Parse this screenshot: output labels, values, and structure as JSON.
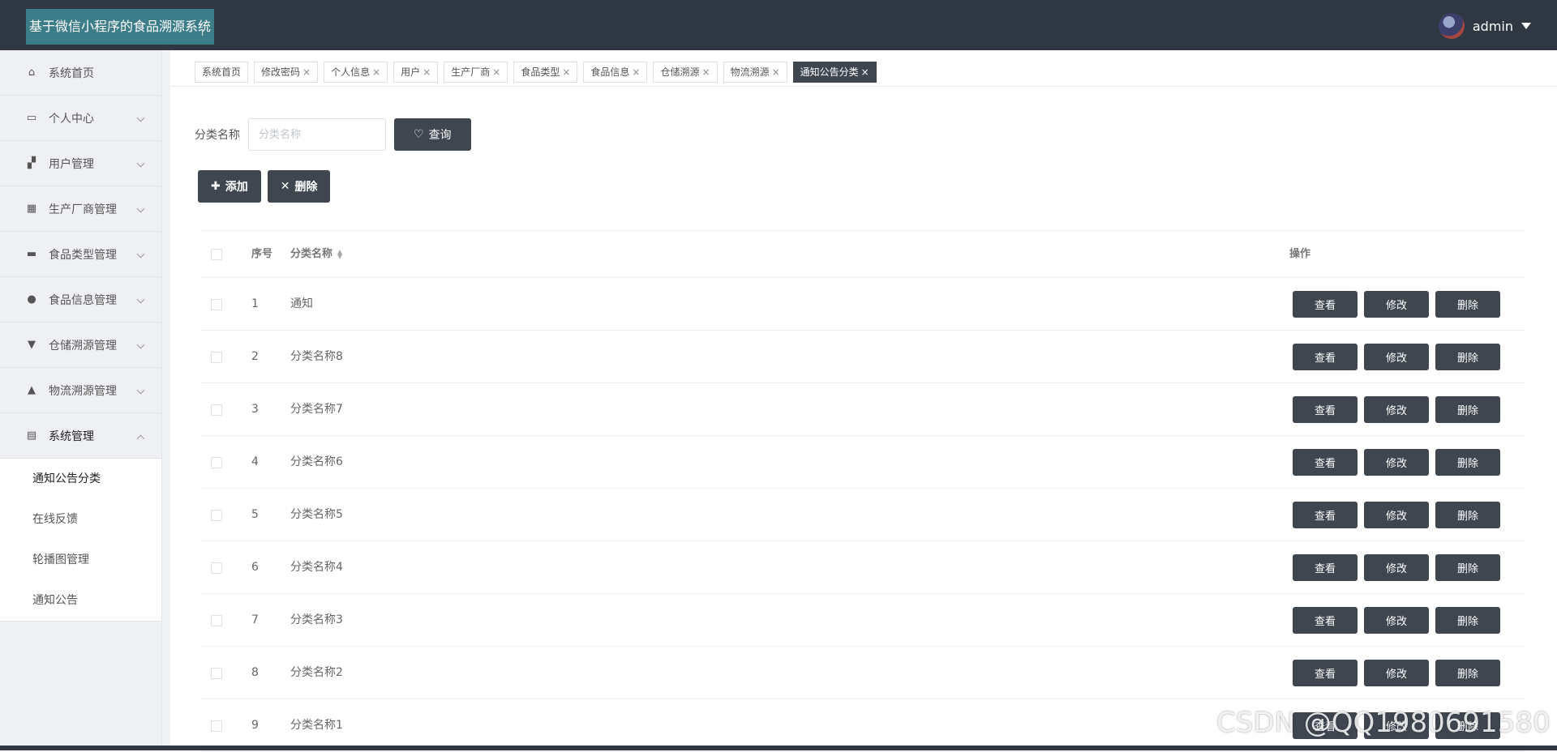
{
  "header": {
    "app_title": "基于微信小程序的食品溯源系统",
    "username": "admin"
  },
  "sidebar": {
    "items": [
      {
        "label": "系统首页",
        "icon": "home-icon",
        "glyph": "⌂",
        "expandable": false
      },
      {
        "label": "个人中心",
        "icon": "card-icon",
        "glyph": "▭",
        "expandable": true
      },
      {
        "label": "用户管理",
        "icon": "user-icon",
        "glyph": "▞",
        "expandable": true
      },
      {
        "label": "生产厂商管理",
        "icon": "grid-icon",
        "glyph": "▦",
        "expandable": true
      },
      {
        "label": "食品类型管理",
        "icon": "chat-icon",
        "glyph": "▬",
        "expandable": true
      },
      {
        "label": "食品信息管理",
        "icon": "pin-icon",
        "glyph": "●",
        "expandable": true
      },
      {
        "label": "仓储溯源管理",
        "icon": "stamp-icon",
        "glyph": "▼",
        "expandable": true
      },
      {
        "label": "物流溯源管理",
        "icon": "person-icon",
        "glyph": "▲",
        "expandable": true
      },
      {
        "label": "系统管理",
        "icon": "clipboard-icon",
        "glyph": "▤",
        "expandable": true,
        "open": true
      }
    ],
    "submenu": [
      "通知公告分类",
      "在线反馈",
      "轮播图管理",
      "通知公告"
    ]
  },
  "tabs": [
    {
      "label": "系统首页",
      "closable": false
    },
    {
      "label": "修改密码",
      "closable": true
    },
    {
      "label": "个人信息",
      "closable": true
    },
    {
      "label": "用户",
      "closable": true
    },
    {
      "label": "生产厂商",
      "closable": true
    },
    {
      "label": "食品类型",
      "closable": true
    },
    {
      "label": "食品信息",
      "closable": true
    },
    {
      "label": "仓储溯源",
      "closable": true
    },
    {
      "label": "物流溯源",
      "closable": true
    },
    {
      "label": "通知公告分类",
      "closable": true,
      "active": true
    }
  ],
  "search": {
    "label": "分类名称",
    "placeholder": "分类名称",
    "button": "查询"
  },
  "actions": {
    "add": "添加",
    "delete": "删除"
  },
  "table": {
    "headers": {
      "index": "序号",
      "name": "分类名称",
      "ops": "操作"
    },
    "op_labels": {
      "view": "查看",
      "edit": "修改",
      "delete": "删除"
    },
    "rows": [
      {
        "index": "1",
        "name": "通知"
      },
      {
        "index": "2",
        "name": "分类名称8"
      },
      {
        "index": "3",
        "name": "分类名称7"
      },
      {
        "index": "4",
        "name": "分类名称6"
      },
      {
        "index": "5",
        "name": "分类名称5"
      },
      {
        "index": "6",
        "name": "分类名称4"
      },
      {
        "index": "7",
        "name": "分类名称3"
      },
      {
        "index": "8",
        "name": "分类名称2"
      },
      {
        "index": "9",
        "name": "分类名称1"
      }
    ]
  },
  "watermark": "CSDN @QQ1980691580",
  "colors": {
    "topbar": "#2f3742",
    "title_bg": "#3c7d89",
    "button": "#3f4650"
  }
}
